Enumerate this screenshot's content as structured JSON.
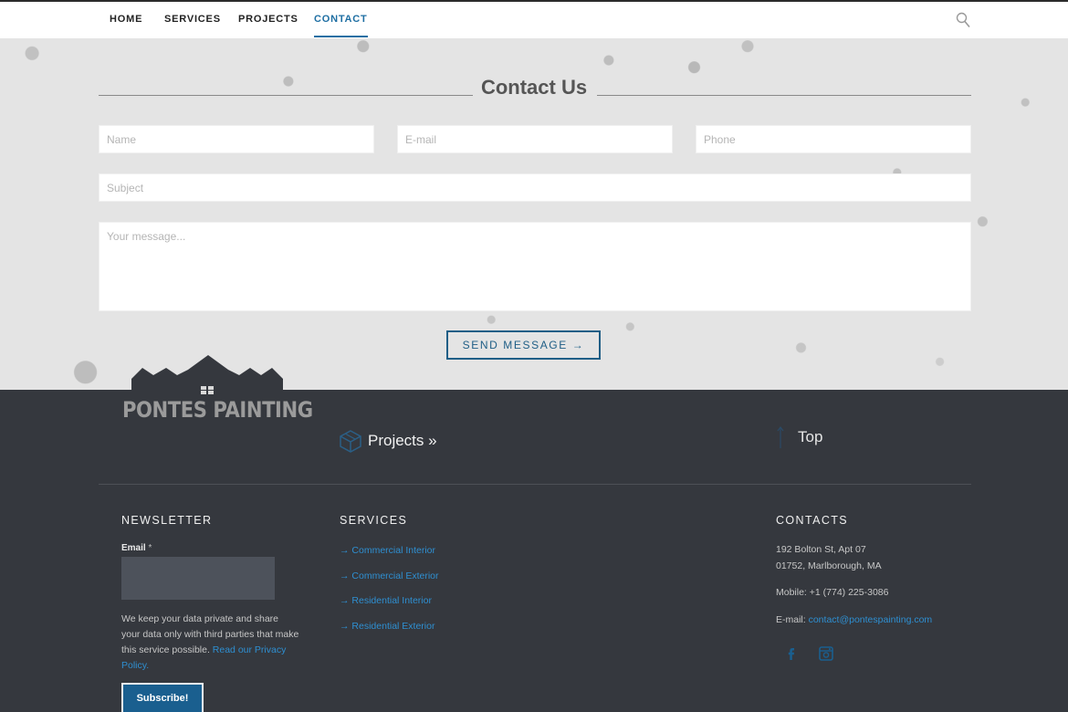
{
  "nav": {
    "items": [
      {
        "label": "HOME"
      },
      {
        "label": "SERVICES"
      },
      {
        "label": "PROJECTS"
      },
      {
        "label": "CONTACT",
        "active": true
      }
    ],
    "search_icon": "search-icon",
    "active_color": "#1f6fa3"
  },
  "contact": {
    "title": "Contact Us",
    "name_placeholder": "Name",
    "email_placeholder": "E-mail",
    "phone_placeholder": "Phone",
    "subject_placeholder": "Subject",
    "message_placeholder": "Your message...",
    "send_label": "SEND MESSAGE →"
  },
  "logo": {
    "text": "PONTES PAINTING"
  },
  "footer": {
    "projects_link": "Projects »",
    "top_link": "Top",
    "newsletter": {
      "title": "NEWSLETTER",
      "email_label": "Email",
      "required_mark": "*",
      "privacy_text": "We keep your data private and share your data only with third parties that make this service possible.",
      "privacy_link": "Read our Privacy Policy.",
      "subscribe_label": "Subscribe!"
    },
    "services": {
      "title": "SERVICES",
      "items": [
        {
          "label": "→ Commercial Interior"
        },
        {
          "label": "→ Commercial Exterior"
        },
        {
          "label": "→ Residential Interior"
        },
        {
          "label": "→ Residential Exterior"
        }
      ]
    },
    "contacts": {
      "title": "CONTACTS",
      "address_line1": "192 Bolton St, Apt 07",
      "address_line2": "01752, Marlborough, MA",
      "mobile": "Mobile: +1 (774) 225-3086",
      "email_prefix": "E-mail:",
      "email": "contact@pontespainting.com",
      "social_icons": [
        "facebook-icon",
        "instagram-icon"
      ]
    },
    "link_color": "#2e8fd1",
    "background": "#35383e"
  }
}
